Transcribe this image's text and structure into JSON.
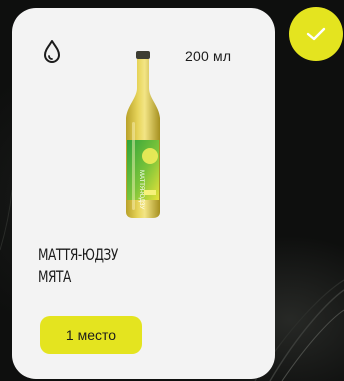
{
  "card": {
    "volume": "200 мл",
    "name_line1": "МАТТЯ-ЮДЗУ",
    "name_line2": "МЯТА",
    "place_label": "1 место",
    "selected": true
  },
  "bottle_label": {
    "text": "МАТТЯ-ЮДЗУ"
  },
  "icons": {
    "drop": "water-drop-icon",
    "check": "checkmark-icon"
  },
  "colors": {
    "accent": "#e4e41f",
    "card_bg": "#f3f3f3",
    "page_bg": "#0e0f0e",
    "text": "#1c1c1c"
  }
}
